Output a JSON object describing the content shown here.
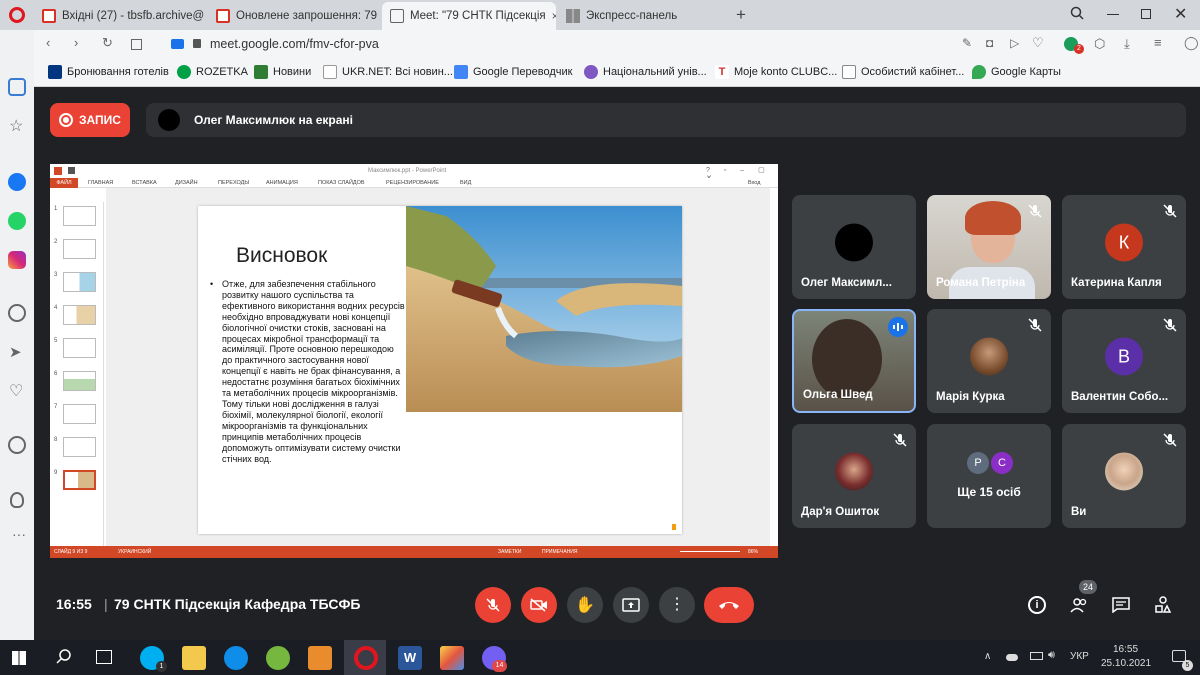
{
  "browser": {
    "tabs": [
      {
        "label": "Вхідні (27) - tbsfb.archive@"
      },
      {
        "label": "Оновлене запрошення: 79"
      },
      {
        "label": "Meet: \"79 СНТК Підсекція"
      },
      {
        "label": "Экспресс-панель"
      }
    ],
    "url": "meet.google.com/fmv-cfor-pva",
    "bookmarks": [
      {
        "label": "Бронювання готелів"
      },
      {
        "label": "ROZETKA"
      },
      {
        "label": "Новини"
      },
      {
        "label": "UKR.NET: Всі новин..."
      },
      {
        "label": "Google Переводчик"
      },
      {
        "label": "Національний унів..."
      },
      {
        "label": "Moje konto CLUBC..."
      },
      {
        "label": "Особистий кабінет..."
      },
      {
        "label": "Google Карты"
      }
    ],
    "extension_badge": "2"
  },
  "meet": {
    "record_label": "ЗАПИС",
    "presenter_text": "Олег Максимлюк на екрані",
    "time": "16:55",
    "meeting_name": "79 СНТК Підсекція Кафедра ТБСФБ",
    "participants_count": "24",
    "tiles": [
      {
        "name": "Олег Максимл...",
        "initial": "",
        "color": "#000000"
      },
      {
        "name": "Романа Петріна",
        "initial": "",
        "color": ""
      },
      {
        "name": "Катерина Капля",
        "initial": "К",
        "color": "#c5381e"
      },
      {
        "name": "Ольга Швед",
        "initial": "",
        "color": ""
      },
      {
        "name": "Марія Курка",
        "initial": "",
        "color": ""
      },
      {
        "name": "Валентин Собо...",
        "initial": "В",
        "color": "#5b2fa8"
      },
      {
        "name": "Дар'я Ошиток",
        "initial": "",
        "color": ""
      },
      {
        "name": "Ще 15 осіб",
        "initial": "P",
        "initial2": "C",
        "color": "#5f6c7d",
        "color2": "#8a2ec7"
      },
      {
        "name": "Ви",
        "initial": "",
        "color": ""
      }
    ]
  },
  "ppt": {
    "window_title": "Максимлюк.ppt - PowerPoint",
    "file_tab": "ФАЙЛ",
    "ribbon_tabs": [
      "ГЛАВНАЯ",
      "ВСТАВКА",
      "ДИЗАЙН",
      "ПЕРЕХОДЫ",
      "АНИМАЦИЯ",
      "ПОКАЗ СЛАЙДОВ",
      "РЕЦЕНЗИРОВАНИЕ",
      "ВИД"
    ],
    "signin": "Вход",
    "thumb_numbers": [
      "1",
      "2",
      "3",
      "4",
      "5",
      "6",
      "7",
      "8",
      "9"
    ],
    "status_left": "СЛАЙД 9 ИЗ 9",
    "status_lang": "УКРАИНСКИЙ",
    "status_notes": "ЗАМЕТКИ",
    "status_comments": "ПРИМЕЧАНИЯ",
    "zoom": "86%",
    "slide_title": "Висновок",
    "slide_body": "Отже, для забезпечення стабільного розвитку нашого суспільства та ефективного використання водних ресурсів необхідно впроваджувати нові концепції біологічної очистки стоків, засновані на процесах мікробної трансформації та асиміляції. Проте основною перешкодою до практичного застосування нової концепції є навіть не брак фінансування, а недостатнє розуміння багатьох біохімічних та метаболічних процесів мікроорганізмів. Тому тільки нові дослідження в галузі біохімії, молекулярної біології, екології мікроорганізмів та функціональних принципів метаболічних процесів допоможуть оптимізувати систему очистки стічних вод."
  },
  "taskbar": {
    "lang": "УКР",
    "time": "16:55",
    "date": "25.10.2021",
    "skype_badge": "1",
    "viber_badge": "14",
    "notif_badge": "5"
  }
}
